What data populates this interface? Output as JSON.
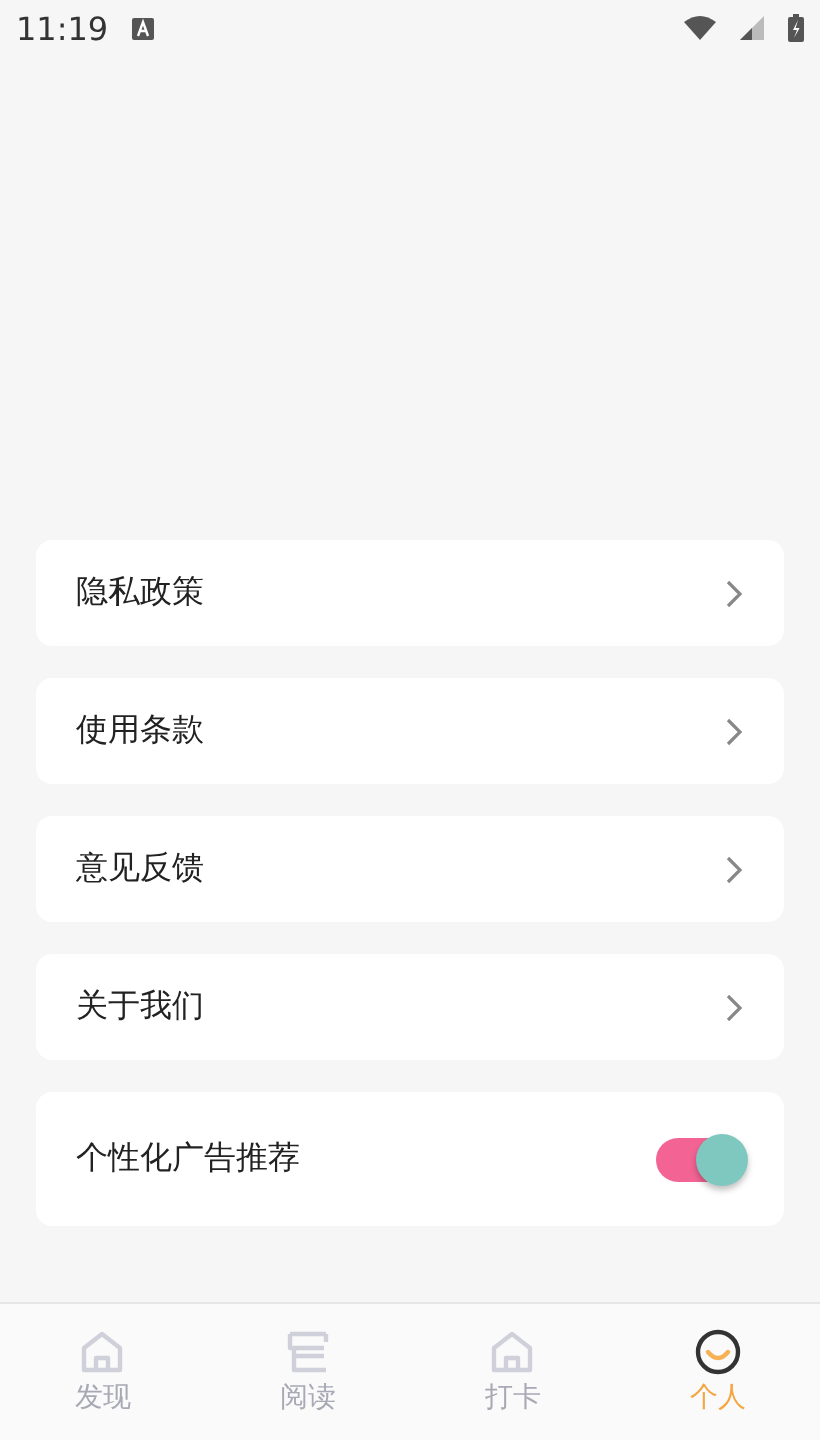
{
  "status_bar": {
    "time": "11:19"
  },
  "menu": [
    {
      "kind": "link",
      "label": "隐私政策"
    },
    {
      "kind": "link",
      "label": "使用条款"
    },
    {
      "kind": "link",
      "label": "意见反馈"
    },
    {
      "kind": "link",
      "label": "关于我们"
    },
    {
      "kind": "toggle",
      "label": "个性化广告推荐",
      "on": true
    }
  ],
  "tabs": [
    {
      "label": "发现",
      "kind": "home",
      "selected": false
    },
    {
      "label": "阅读",
      "kind": "book",
      "selected": false
    },
    {
      "label": "打卡",
      "kind": "home",
      "selected": false
    },
    {
      "label": "个人",
      "kind": "smile",
      "selected": true
    }
  ]
}
